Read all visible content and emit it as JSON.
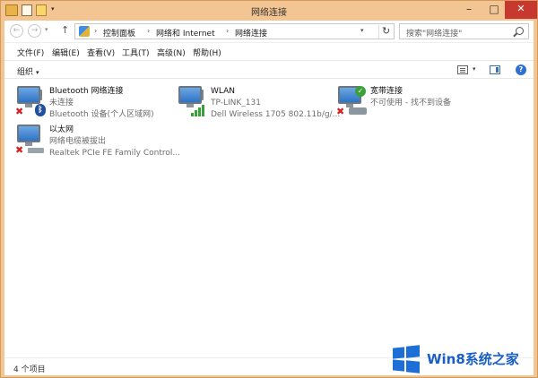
{
  "window": {
    "title": "网络连接"
  },
  "nav": {
    "breadcrumbs": [
      "控制面板",
      "网络和 Internet",
      "网络连接"
    ],
    "search_placeholder": "搜索\"网络连接\""
  },
  "menu": {
    "items": [
      "文件(F)",
      "编辑(E)",
      "查看(V)",
      "工具(T)",
      "高级(N)",
      "帮助(H)"
    ]
  },
  "command": {
    "organize_label": "组织"
  },
  "connections": [
    {
      "name": "Bluetooth 网络连接",
      "status": "未连接",
      "device": "Bluetooth 设备(个人区域网)",
      "icon": "bluetooth-network-icon",
      "state": "disconnected"
    },
    {
      "name": "WLAN",
      "status": "TP-LINK_131",
      "device": "Dell Wireless 1705 802.11b/g/...",
      "icon": "wlan-network-icon",
      "state": "connected"
    },
    {
      "name": "宽带连接",
      "status": "不可使用 - 找不到设备",
      "device": "",
      "icon": "broadband-connection-icon",
      "state": "unavailable"
    },
    {
      "name": "以太网",
      "status": "网络电缆被拔出",
      "device": "Realtek PCIe FE Family Control...",
      "icon": "ethernet-network-icon",
      "state": "disconnected"
    }
  ],
  "status_bar": {
    "item_count": "4 个项目"
  },
  "watermark": {
    "text": "Win8系统之家"
  },
  "colors": {
    "titlebar": "#f3c592",
    "accent": "#2e73c6",
    "error": "#d32020",
    "signal": "#3aa13a"
  }
}
